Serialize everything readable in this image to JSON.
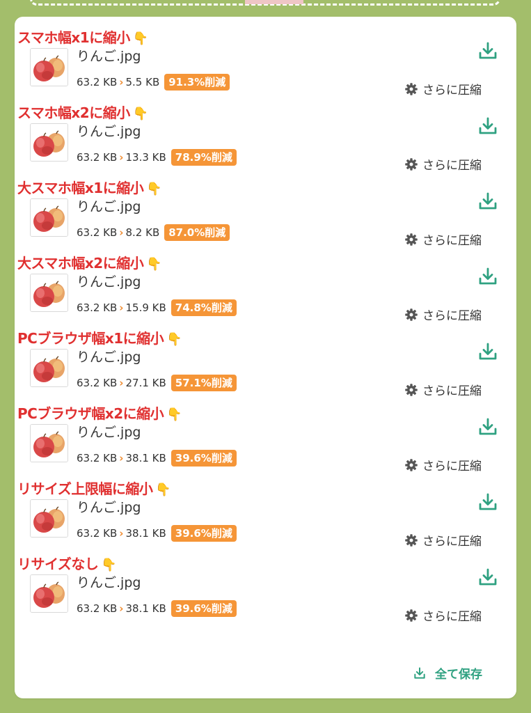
{
  "results": {
    "items": [
      {
        "title": "スマホ幅x1に縮小",
        "filename": "りんご.jpg",
        "original_size": "63.2 KB",
        "new_size": "5.5 KB",
        "reduction": "91.3%削減",
        "more_label": "さらに圧縮"
      },
      {
        "title": "スマホ幅x2に縮小",
        "filename": "りんご.jpg",
        "original_size": "63.2 KB",
        "new_size": "13.3 KB",
        "reduction": "78.9%削減",
        "more_label": "さらに圧縮"
      },
      {
        "title": "大スマホ幅x1に縮小",
        "filename": "りんご.jpg",
        "original_size": "63.2 KB",
        "new_size": "8.2 KB",
        "reduction": "87.0%削減",
        "more_label": "さらに圧縮"
      },
      {
        "title": "大スマホ幅x2に縮小",
        "filename": "りんご.jpg",
        "original_size": "63.2 KB",
        "new_size": "15.9 KB",
        "reduction": "74.8%削減",
        "more_label": "さらに圧縮"
      },
      {
        "title": "PCブラウザ幅x1に縮小",
        "filename": "りんご.jpg",
        "original_size": "63.2 KB",
        "new_size": "27.1 KB",
        "reduction": "57.1%削減",
        "more_label": "さらに圧縮"
      },
      {
        "title": "PCブラウザ幅x2に縮小",
        "filename": "りんご.jpg",
        "original_size": "63.2 KB",
        "new_size": "38.1 KB",
        "reduction": "39.6%削減",
        "more_label": "さらに圧縮"
      },
      {
        "title": "リサイズ上限幅に縮小",
        "filename": "りんご.jpg",
        "original_size": "63.2 KB",
        "new_size": "38.1 KB",
        "reduction": "39.6%削減",
        "more_label": "さらに圧縮"
      },
      {
        "title": "リサイズなし",
        "filename": "りんご.jpg",
        "original_size": "63.2 KB",
        "new_size": "38.1 KB",
        "reduction": "39.6%削減",
        "more_label": "さらに圧縮"
      }
    ],
    "save_all_label": "全て保存"
  },
  "icons": {
    "title_hand": "pointing-hand-icon",
    "download": "download-icon",
    "settings": "gear-icon",
    "thumbnail": "apple-photo-thumbnail"
  },
  "colors": {
    "background": "#a3be6b",
    "title_red": "#e03030",
    "badge_orange": "#f59537",
    "accent_green": "#2fa181"
  }
}
